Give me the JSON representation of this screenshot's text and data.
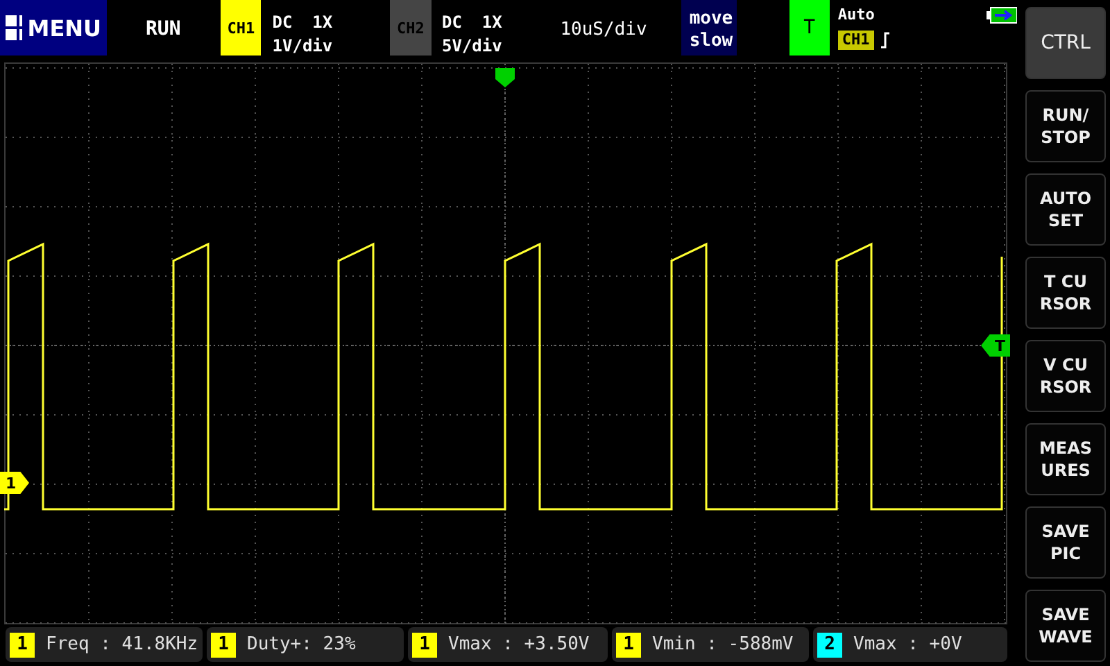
{
  "menu": {
    "label": "MENU"
  },
  "run_state": "RUN",
  "channels": [
    {
      "name": "CH1",
      "coupling": "DC  1X",
      "scale": "1V/div",
      "color": "#ffff00"
    },
    {
      "name": "CH2",
      "coupling": "DC  1X",
      "scale": "5V/div",
      "color": "#454545"
    }
  ],
  "timebase": "10uS/div",
  "move_button": {
    "lines": [
      "move",
      "slow"
    ]
  },
  "trigger": {
    "label": "T",
    "mode": "Auto",
    "source": "CH1",
    "rising_edge": true
  },
  "screen": {
    "channel_marker": "1",
    "trigger_level_marker": "T"
  },
  "side_buttons": [
    {
      "lines": [
        "CTRL"
      ],
      "selected": true
    },
    {
      "lines": [
        "RUN/",
        "STOP"
      ],
      "selected": false
    },
    {
      "lines": [
        "AUTO",
        "SET"
      ],
      "selected": false
    },
    {
      "lines": [
        "T  CU",
        "RSOR"
      ],
      "selected": false
    },
    {
      "lines": [
        "V  CU",
        "RSOR"
      ],
      "selected": false
    },
    {
      "lines": [
        "MEAS",
        "URES"
      ],
      "selected": false
    },
    {
      "lines": [
        "SAVE",
        "PIC"
      ],
      "selected": false
    },
    {
      "lines": [
        "SAVE",
        "WAVE"
      ],
      "selected": false
    }
  ],
  "measurements": [
    {
      "channel": "1",
      "color": "#ffff00",
      "text": "Freq : 41.8KHz"
    },
    {
      "channel": "1",
      "color": "#ffff00",
      "text": "Duty+: 23%"
    },
    {
      "channel": "1",
      "color": "#ffff00",
      "text": "Vmax : +3.50V"
    },
    {
      "channel": "1",
      "color": "#ffff00",
      "text": "Vmin : -588mV"
    },
    {
      "channel": "2",
      "color": "#00ffff",
      "text": "Vmax : +0V"
    }
  ]
}
